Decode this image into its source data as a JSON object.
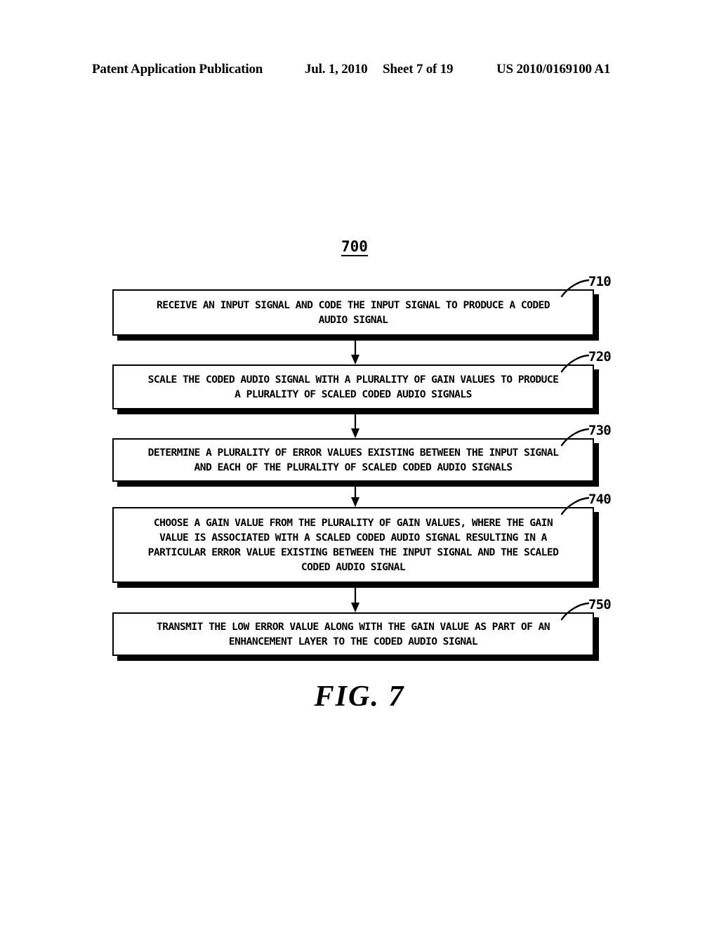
{
  "page": {
    "background_color": "#ffffff",
    "ink_color": "#000000"
  },
  "header": {
    "publication": "Patent Application Publication",
    "date": "Jul. 1, 2010",
    "sheet": "Sheet 7 of 19",
    "publication_number": "US 2010/0169100 A1"
  },
  "figure": {
    "id_label": "700",
    "caption": "FIG.  7",
    "steps": [
      {
        "ref": "710",
        "text": "RECEIVE AN INPUT SIGNAL AND CODE THE INPUT SIGNAL TO PRODUCE A CODED\nAUDIO SIGNAL"
      },
      {
        "ref": "720",
        "text": "SCALE THE CODED AUDIO SIGNAL WITH A PLURALITY OF GAIN VALUES TO PRODUCE\nA PLURALITY OF SCALED CODED AUDIO SIGNALS"
      },
      {
        "ref": "730",
        "text": "DETERMINE A PLURALITY OF ERROR VALUES EXISTING BETWEEN THE INPUT SIGNAL\nAND EACH OF THE PLURALITY OF SCALED CODED AUDIO SIGNALS"
      },
      {
        "ref": "740",
        "text": "CHOOSE A GAIN VALUE FROM THE PLURALITY OF GAIN VALUES, WHERE THE GAIN\nVALUE IS ASSOCIATED WITH A SCALED CODED AUDIO SIGNAL RESULTING IN A\nPARTICULAR ERROR VALUE EXISTING BETWEEN THE INPUT SIGNAL AND THE SCALED\nCODED AUDIO SIGNAL"
      },
      {
        "ref": "750",
        "text": "TRANSMIT THE LOW ERROR VALUE ALONG WITH THE GAIN VALUE AS PART OF AN\nENHANCEMENT LAYER TO THE CODED AUDIO SIGNAL"
      }
    ]
  }
}
